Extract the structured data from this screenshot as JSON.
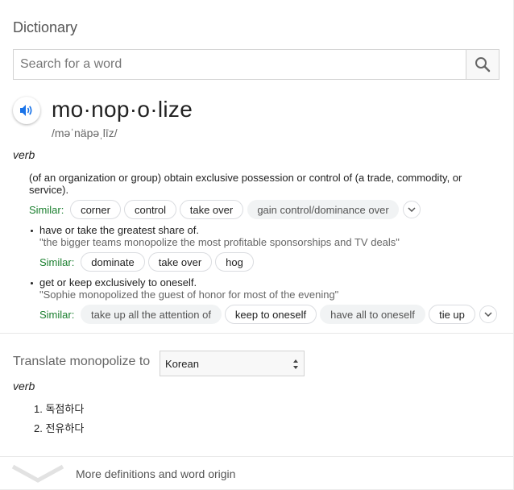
{
  "title": "Dictionary",
  "search": {
    "placeholder": "Search for a word",
    "button_icon": "search-icon"
  },
  "entry": {
    "word": "mo·nop·o·lize",
    "phonetic": "/məˈnäpəˌlīz/",
    "pos": "verb",
    "audio_icon": "speaker-icon"
  },
  "definitions": [
    {
      "text": "(of an organization or group) obtain exclusive possession or control of (a trade, commodity, or service).",
      "similar_label": "Similar:",
      "similar": [
        "corner",
        "control",
        "take over",
        "gain control/dominance over"
      ]
    },
    {
      "text": "have or take the greatest share of.",
      "example": "\"the bigger teams monopolize the most profitable sponsorships and TV deals\"",
      "similar_label": "Similar:",
      "similar": [
        "dominate",
        "take over",
        "hog"
      ]
    },
    {
      "text": "get or keep exclusively to oneself.",
      "example": "\"Sophie monopolized the guest of honor for most of the evening\"",
      "similar_label": "Similar:",
      "similar": [
        "take up all the attention of",
        "keep to oneself",
        "have all to oneself",
        "tie up"
      ]
    }
  ],
  "translate": {
    "label": "Translate monopolize to",
    "language": "Korean",
    "pos": "verb",
    "items": [
      "1. 독점하다",
      "2. 전유하다"
    ]
  },
  "footer": {
    "link": "More definitions and word origin"
  },
  "colors": {
    "similar_label": "#1a7f2e",
    "accent_blue": "#1a73e8"
  }
}
